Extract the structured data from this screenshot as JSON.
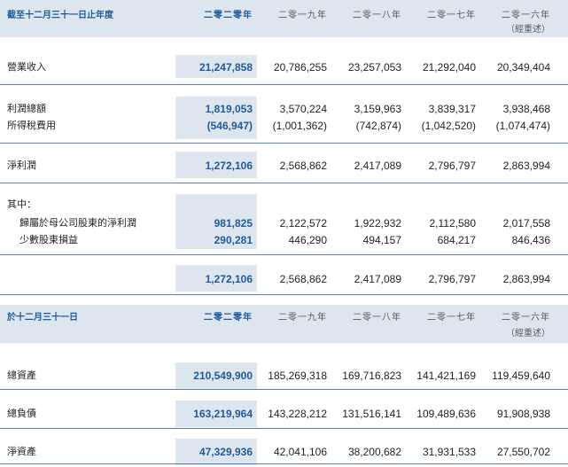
{
  "section1": {
    "title": "截至十二月三十一日止年度",
    "years": [
      "二零二零年",
      "二零一九年",
      "二零一八年",
      "二零一七年",
      "二零一六年"
    ],
    "restated": "（經重述）",
    "rows": [
      {
        "label": "營業收入",
        "values": [
          "21,247,858",
          "20,786,255",
          "23,257,053",
          "21,292,040",
          "20,349,404"
        ]
      },
      {
        "label": "利潤總額",
        "values": [
          "1,819,053",
          "3,570,224",
          "3,159,963",
          "3,839,317",
          "3,938,468"
        ]
      },
      {
        "label": "所得稅費用",
        "values": [
          "(546,947)",
          "(1,001,362)",
          "(742,874)",
          "(1,042,520)",
          "(1,074,474)"
        ]
      },
      {
        "label": "淨利潤",
        "values": [
          "1,272,106",
          "2,568,862",
          "2,417,089",
          "2,796,797",
          "2,863,994"
        ]
      },
      {
        "label": "其中：",
        "values": []
      },
      {
        "label": "歸屬於母公司股東的淨利潤",
        "values": [
          "981,825",
          "2,122,572",
          "1,922,932",
          "2,112,580",
          "2,017,558"
        ]
      },
      {
        "label": "少數股東損益",
        "values": [
          "290,281",
          "446,290",
          "494,157",
          "684,217",
          "846,436"
        ]
      },
      {
        "label": "",
        "values": [
          "1,272,106",
          "2,568,862",
          "2,417,089",
          "2,796,797",
          "2,863,994"
        ]
      }
    ]
  },
  "section2": {
    "title": "於十二月三十一日",
    "years": [
      "二零二零年",
      "二零一九年",
      "二零一八年",
      "二零一七年",
      "二零一六年"
    ],
    "restated": "（經重述）",
    "rows": [
      {
        "label": "總資產",
        "values": [
          "210,549,900",
          "185,269,318",
          "169,716,823",
          "141,421,169",
          "119,459,640"
        ]
      },
      {
        "label": "總負債",
        "values": [
          "163,219,964",
          "143,228,212",
          "131,516,141",
          "109,489,636",
          "91,908,938"
        ]
      },
      {
        "label": "淨資產",
        "values": [
          "47,329,936",
          "42,041,106",
          "38,200,682",
          "31,931,533",
          "27,550,702"
        ]
      }
    ]
  }
}
